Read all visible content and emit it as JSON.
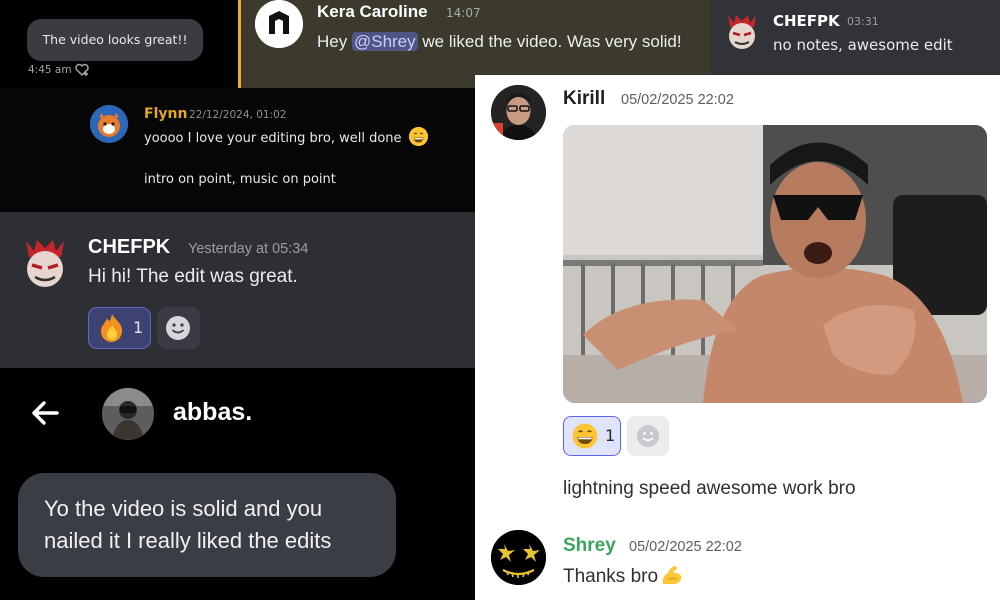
{
  "panel_dm_small": {
    "bubble_text": "The video looks great!!",
    "timestamp": "4:45 am",
    "status_icon": "heart-add-icon"
  },
  "panel_kera": {
    "author": "Kera Caroline",
    "time": "14:07",
    "text_before": "Hey ",
    "mention": "@Shrey",
    "text_after": " we liked the video. Was very solid!",
    "highlight_color": "#e7b324"
  },
  "panel_chefpk_top": {
    "author": "CHEFPK",
    "time": "03:31",
    "text": "no notes, awesome edit"
  },
  "panel_flynn": {
    "author": "Flynn",
    "time": "22/12/2024, 01:02",
    "line1": "yoooo I love your editing bro, well done",
    "line1_emoji": "grinning-sweat-emoji",
    "line2": "intro on point, music on point",
    "author_color": "#e4a721"
  },
  "panel_chefpk_main": {
    "author": "CHEFPK",
    "time": "Yesterday at 05:34",
    "text": "Hi hi! The edit was great.",
    "reaction_emoji": "fire-emoji",
    "reaction_count": "1",
    "add_reaction_icon": "smiley-add-icon"
  },
  "panel_abbas": {
    "back_icon": "arrow-left-icon",
    "contact_name": "abbas.",
    "bubble_text": "Yo the video is solid and you nailed it I really liked the edits"
  },
  "panel_light": {
    "author1": "Kirill",
    "time1": "05/02/2025 22:02",
    "gif_alt": "reaction-gif",
    "reaction_emoji": "grinning-emoji",
    "reaction_count": "1",
    "add_reaction_icon": "smiley-add-icon",
    "message2": "lightning speed awesome work bro",
    "author2": "Shrey",
    "time2": "05/02/2025 22:02",
    "message3": "Thanks bro",
    "message3_emoji": "flexed-biceps-emoji",
    "author2_color": "#3ba55c"
  }
}
